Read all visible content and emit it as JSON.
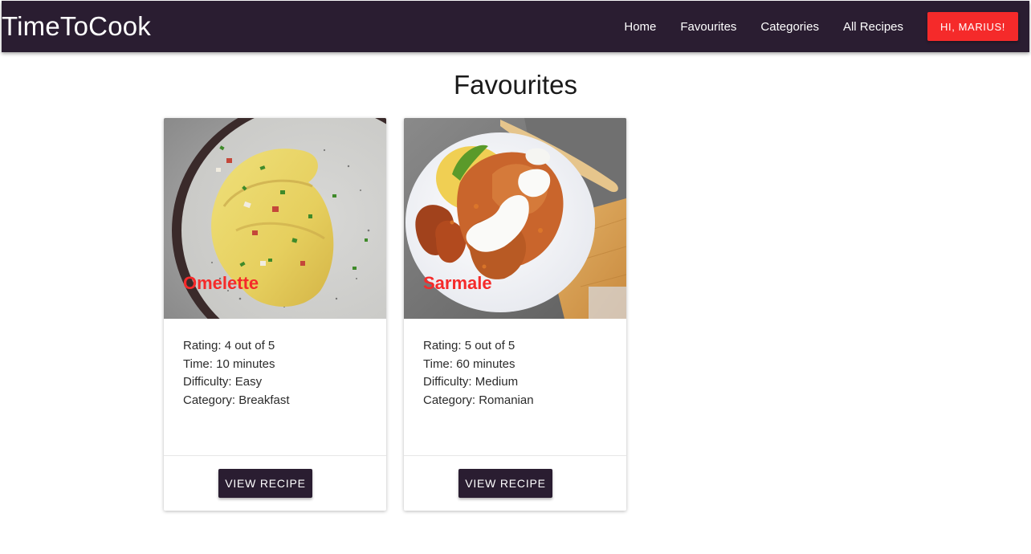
{
  "navbar": {
    "brand": "TimeToCook",
    "links": [
      "Home",
      "Favourites",
      "Categories",
      "All Recipes"
    ],
    "user_button": "HI, MARIUS!",
    "background_color": "#2a1d31",
    "accent_color": "#f52a2a"
  },
  "page": {
    "title": "Favourites"
  },
  "recipes": [
    {
      "title": "Omelette",
      "rating": "Rating: 4 out of 5",
      "time": "Time: 10 minutes",
      "difficulty": "Difficulty: Easy",
      "category": "Category: Breakfast",
      "button": "VIEW RECIPE",
      "image_icon": "omelette-photo"
    },
    {
      "title": "Sarmale",
      "rating": "Rating: 5 out of 5",
      "time": "Time: 60 minutes",
      "difficulty": "Difficulty: Medium",
      "category": "Category: Romanian",
      "button": "VIEW RECIPE",
      "image_icon": "sarmale-photo"
    }
  ]
}
